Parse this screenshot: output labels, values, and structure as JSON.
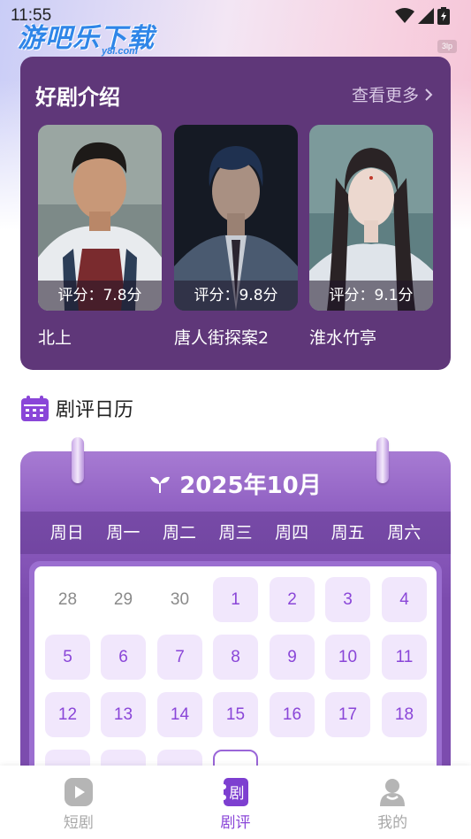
{
  "status_bar": {
    "time": "11:55",
    "icons": [
      "wifi-icon",
      "signal-icon",
      "battery-icon"
    ]
  },
  "watermark": {
    "title": "游吧乐下载",
    "sub": "y8l.com",
    "badge": "3lp"
  },
  "featured": {
    "title": "好剧介绍",
    "see_more": "查看更多",
    "dramas": [
      {
        "name": "北上",
        "score": "评分：7.8分"
      },
      {
        "name": "唐人街探案2",
        "score": "评分：9.8分"
      },
      {
        "name": "淮水竹亭",
        "score": "评分：9.1分"
      }
    ]
  },
  "calendar": {
    "heading": "剧评日历",
    "month": "2025年10月",
    "weekdays": [
      "周日",
      "周一",
      "周二",
      "周三",
      "周四",
      "周五",
      "周六"
    ],
    "prev_days": [
      "28",
      "29",
      "30"
    ],
    "days": [
      "1",
      "2",
      "3",
      "4",
      "5",
      "6",
      "7",
      "8",
      "9",
      "10",
      "11",
      "12",
      "13",
      "14",
      "15",
      "16",
      "17",
      "18"
    ]
  },
  "bottom_nav": {
    "items": [
      {
        "label": "短剧",
        "icon": "play-icon"
      },
      {
        "label": "剧评",
        "icon": "review-icon"
      },
      {
        "label": "我的",
        "icon": "profile-icon"
      }
    ],
    "active": "剧评"
  },
  "colors": {
    "card": "#5f3779",
    "accent": "#8a46d8",
    "day_bg": "#f1e7fc"
  }
}
